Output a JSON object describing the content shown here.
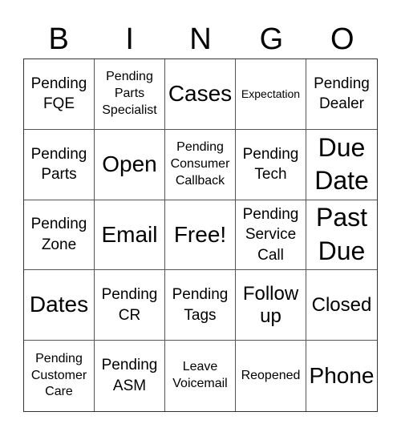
{
  "header": [
    "B",
    "I",
    "N",
    "G",
    "O"
  ],
  "cells": [
    "Pending\nFQE",
    "Pending\nParts\nSpecialist",
    "Cases",
    "Expectation",
    "Pending\nDealer",
    "Pending\nParts",
    "Open",
    "Pending\nConsumer\nCallback",
    "Pending\nTech",
    "Due\nDate",
    "Pending\nZone",
    "Email",
    "Free!",
    "Pending\nService\nCall",
    "Past\nDue",
    "Dates",
    "Pending\nCR",
    "Pending\nTags",
    "Follow\nup",
    "Closed",
    "Pending\nCustomer\nCare",
    "Pending\nASM",
    "Leave\nVoicemail",
    "Reopened",
    "Phone"
  ]
}
